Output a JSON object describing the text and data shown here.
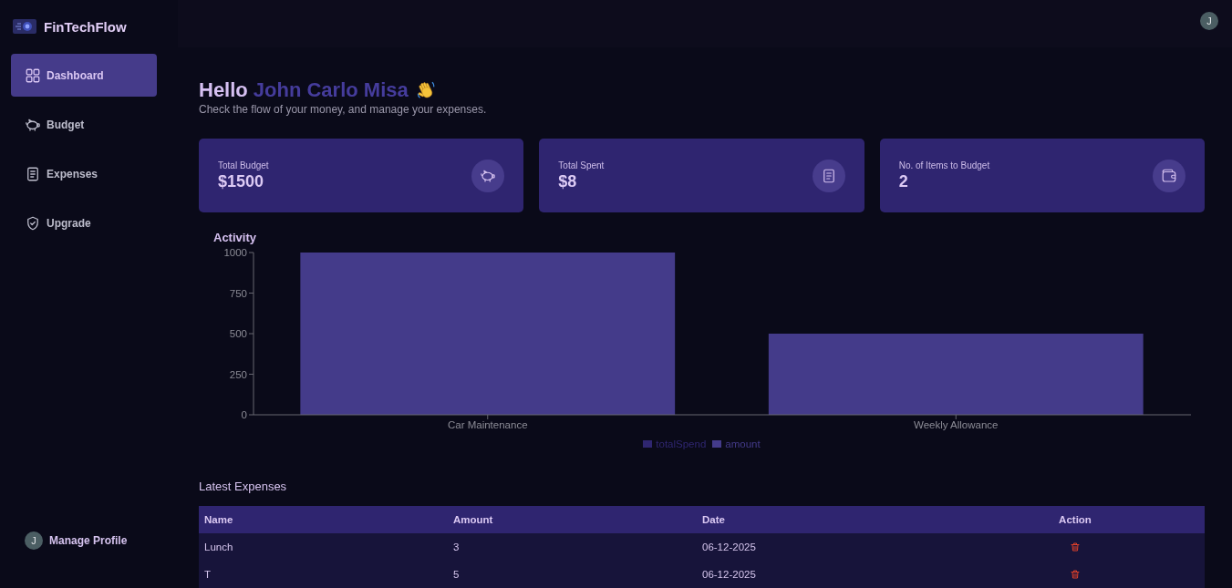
{
  "brand": {
    "name": "FinTechFlow"
  },
  "sidebar": {
    "items": [
      {
        "label": "Dashboard",
        "selected": true
      },
      {
        "label": "Budget",
        "selected": false
      },
      {
        "label": "Expenses",
        "selected": false
      },
      {
        "label": "Upgrade",
        "selected": false
      }
    ],
    "profile": {
      "initial": "J",
      "label": "Manage Profile"
    }
  },
  "header": {
    "avatar_initial": "J"
  },
  "greeting": {
    "hello": "Hello",
    "name": "John Carlo Misa",
    "subtitle": "Check the flow of your money, and manage your expenses."
  },
  "stats": [
    {
      "label": "Total Budget",
      "value": "$1500"
    },
    {
      "label": "Total Spent",
      "value": "$8"
    },
    {
      "label": "No. of Items to Budget",
      "value": "2"
    }
  ],
  "activity": {
    "title": "Activity",
    "chart_data": {
      "type": "bar",
      "categories": [
        "Car Maintenance",
        "Weekly Allowance"
      ],
      "series": [
        {
          "name": "totalSpend",
          "color": "#2f2670",
          "values": [
            null,
            null
          ]
        },
        {
          "name": "amount",
          "color": "#443b8a",
          "values": [
            1000,
            500
          ]
        }
      ],
      "ylim": [
        0,
        1000
      ],
      "yticks": [
        0,
        250,
        500,
        750,
        1000
      ],
      "stacked": true
    }
  },
  "latest_expenses": {
    "title": "Latest Expenses",
    "columns": [
      "Name",
      "Amount",
      "Date",
      "Action"
    ],
    "rows": [
      {
        "name": "Lunch",
        "amount": "3",
        "date": "06-12-2025"
      },
      {
        "name": "T",
        "amount": "5",
        "date": "06-12-2025"
      }
    ]
  }
}
